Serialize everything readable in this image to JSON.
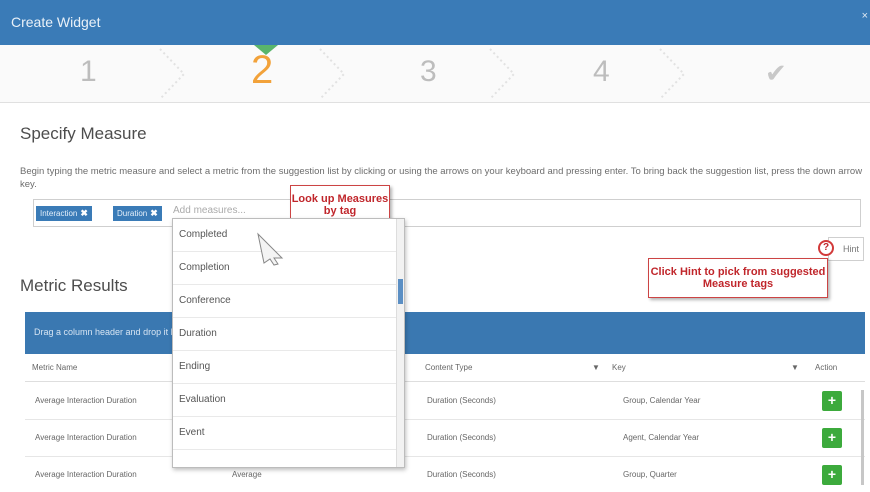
{
  "window": {
    "title": "Create Widget",
    "close": "×"
  },
  "wizard": {
    "steps": [
      "1",
      "2",
      "3",
      "4"
    ],
    "active_step": "2",
    "final_check": "✔"
  },
  "section": {
    "title": "Specify Measure",
    "help": "Begin typing the metric measure and select a metric from the suggestion list by clicking or using the arrows on your keyboard and pressing enter. To bring back the suggestion list, press the down arrow key."
  },
  "tags": [
    {
      "label": "Interaction",
      "remove": "✖"
    },
    {
      "label": "Duration",
      "remove": "✖"
    }
  ],
  "measure_input": {
    "placeholder": "Add measures..."
  },
  "suggestions": [
    "Completed",
    "Completion",
    "Conference",
    "Duration",
    "Ending",
    "Evaluation",
    "Event"
  ],
  "callouts": {
    "lookup": "Look up Measures by tag",
    "hint": "Click Hint to pick from suggested Measure tags"
  },
  "hint_button": {
    "label": "Hint",
    "icon": "?"
  },
  "results": {
    "title": "Metric Results",
    "group_hint": "Drag a column header and drop it here to group by that column",
    "columns": {
      "metric_name": "Metric Name",
      "content_type": "Content Type",
      "key": "Key",
      "action": "Action"
    },
    "rows": [
      {
        "metric": "Average Interaction Duration",
        "aggregation": "",
        "content_type": "Duration (Seconds)",
        "key": "Group, Calendar Year"
      },
      {
        "metric": "Average Interaction Duration",
        "aggregation": "",
        "content_type": "Duration (Seconds)",
        "key": "Agent, Calendar Year"
      },
      {
        "metric": "Average Interaction Duration",
        "aggregation": "Average",
        "content_type": "Duration (Seconds)",
        "key": "Group, Quarter"
      }
    ],
    "add_label": "+"
  },
  "colors": {
    "header": "#3a7bb7",
    "active_step": "#f2a23a",
    "add_button": "#3caa3c",
    "callout": "#c0262b"
  }
}
